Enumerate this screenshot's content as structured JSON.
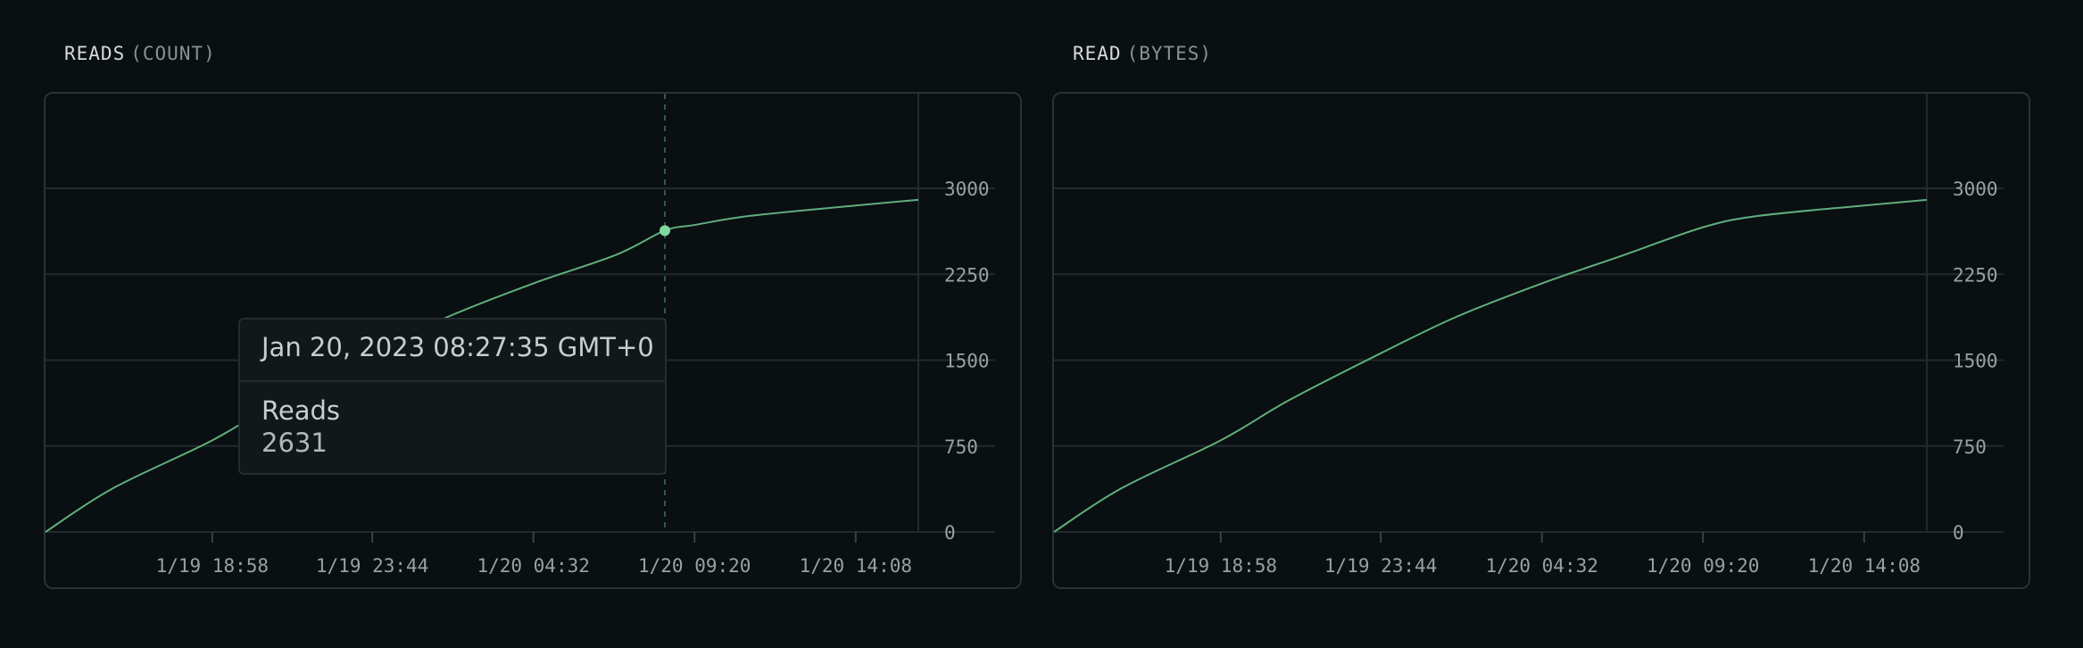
{
  "charts": [
    {
      "title": "READS",
      "subtitle": "(COUNT)",
      "chart_data": {
        "type": "line",
        "x": [
          "1/19 14:00",
          "1/19 16:00",
          "1/19 18:58",
          "1/19 21:00",
          "1/19 23:44",
          "1/20 02:00",
          "1/20 04:32",
          "1/20 07:00",
          "1/20 08:27",
          "1/20 09:20",
          "1/20 11:00",
          "1/20 14:08",
          "1/20 16:00"
        ],
        "y": [
          0,
          380,
          800,
          1150,
          1560,
          1880,
          2170,
          2420,
          2631,
          2680,
          2760,
          2850,
          2900
        ],
        "x_ticks": [
          "1/19 18:58",
          "1/19 23:44",
          "1/20 04:32",
          "1/20 09:20",
          "1/20 14:08"
        ],
        "y_ticks": [
          "0",
          "750",
          "1500",
          "2250",
          "3000"
        ],
        "ylim": [
          0,
          3000
        ],
        "grid": true,
        "highlight": {
          "x": "1/20 08:27",
          "y": 2631
        }
      },
      "tooltip": {
        "date": "Jan 20, 2023 08:27:35 GMT+0",
        "label": "Reads",
        "value": "2631"
      }
    },
    {
      "title": "READ",
      "subtitle": "(BYTES)",
      "chart_data": {
        "type": "line",
        "x": [
          "1/19 14:00",
          "1/19 16:00",
          "1/19 18:58",
          "1/19 21:00",
          "1/19 23:44",
          "1/20 02:00",
          "1/20 04:32",
          "1/20 07:00",
          "1/20 09:20",
          "1/20 11:00",
          "1/20 14:08",
          "1/20 16:00"
        ],
        "y": [
          0,
          380,
          800,
          1150,
          1560,
          1880,
          2170,
          2420,
          2660,
          2760,
          2850,
          2900
        ],
        "x_ticks": [
          "1/19 18:58",
          "1/19 23:44",
          "1/20 04:32",
          "1/20 09:20",
          "1/20 14:08"
        ],
        "y_ticks": [
          "0",
          "750",
          "1500",
          "2250",
          "3000"
        ],
        "ylim": [
          0,
          3000
        ],
        "grid": true
      }
    }
  ],
  "colors": {
    "line": "#5fae7e",
    "point": "#7fd8a0",
    "grid": "#232a2d",
    "axis_text": "#9aa1a3"
  }
}
